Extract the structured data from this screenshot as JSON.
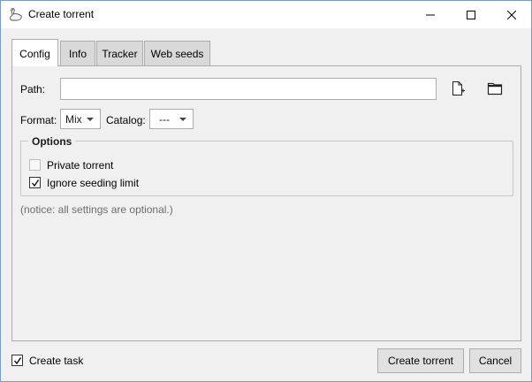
{
  "window": {
    "title": "Create torrent"
  },
  "tabs": [
    {
      "label": "Config",
      "active": true
    },
    {
      "label": "Info",
      "active": false
    },
    {
      "label": "Tracker",
      "active": false
    },
    {
      "label": "Web seeds",
      "active": false
    }
  ],
  "config": {
    "path_label": "Path:",
    "path_value": "",
    "format_label": "Format:",
    "format_value": "Mix",
    "catalog_label": "Catalog:",
    "catalog_value": "---",
    "options_title": "Options",
    "private_torrent_label": "Private torrent",
    "private_torrent_checked": false,
    "ignore_seeding_label": "Ignore seeding limit",
    "ignore_seeding_checked": true,
    "notice": "(notice: all settings are optional.)"
  },
  "footer": {
    "create_task_label": "Create task",
    "create_task_checked": true,
    "create_button": "Create torrent",
    "cancel_button": "Cancel"
  },
  "icons": {
    "app": "goose-icon",
    "new_file": "new-file-icon",
    "open_folder": "open-folder-icon"
  }
}
